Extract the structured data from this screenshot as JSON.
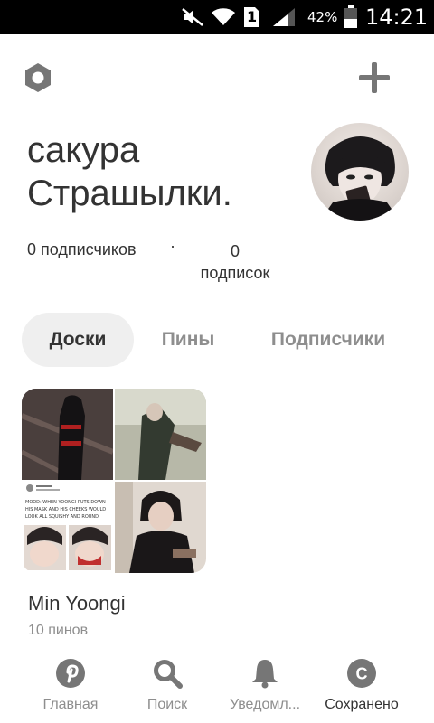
{
  "status_bar": {
    "battery_text": "42%",
    "time": "14:21",
    "sim_label": "1",
    "icons": [
      "mute-icon",
      "wifi-icon",
      "sim-icon",
      "signal-icon",
      "battery-icon"
    ]
  },
  "header": {
    "settings_icon": "hexagon-settings-icon",
    "add_icon": "plus-icon"
  },
  "profile": {
    "name_line1": "сакура",
    "name_line2": "Страшылки.",
    "followers": "0 подписчиков",
    "separator": "·",
    "following_count": "0",
    "following_label": "подписок"
  },
  "tabs": [
    {
      "label": "Доски",
      "active": true
    },
    {
      "label": "Пины",
      "active": false
    },
    {
      "label": "Подписчики",
      "active": false
    }
  ],
  "board": {
    "title": "Min Yoongi",
    "pin_count": "10 пинов",
    "tweet_lines": [
      "MOOD: WHEN YOONGI PUTS DOWN",
      "HIS MASK AND HIS CHEEKS WOULD",
      "LOOK ALL SQUISHY AND ROUND"
    ]
  },
  "nav": [
    {
      "label": "Главная",
      "icon": "pinterest-icon",
      "active": false
    },
    {
      "label": "Поиск",
      "icon": "search-icon",
      "active": false
    },
    {
      "label": "Уведомл...",
      "icon": "bell-icon",
      "active": false
    },
    {
      "label": "Сохранено",
      "icon": "profile-initial-icon",
      "active": true,
      "initial": "С"
    }
  ],
  "colors": {
    "text_primary": "#333333",
    "text_secondary": "#8e8e8e",
    "tab_active_bg": "#efefef",
    "icon_gray": "#767676"
  }
}
